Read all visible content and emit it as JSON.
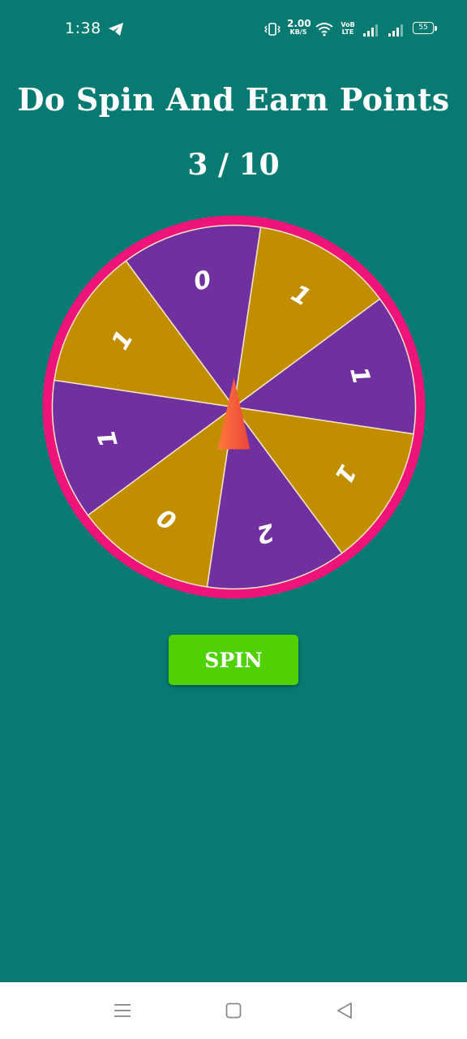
{
  "status_bar": {
    "time": "1:38",
    "net_speed_value": "2.00",
    "net_speed_unit": "KB/S",
    "volte_line1": "VoB",
    "volte_line2": "LTE",
    "battery": "55"
  },
  "header": {
    "title": "Do Spin And Earn Points",
    "spin_count": "3 / 10"
  },
  "wheel": {
    "segments": [
      {
        "label": "0",
        "color": "#7030a0"
      },
      {
        "label": "1",
        "color": "#c38d00"
      },
      {
        "label": "1",
        "color": "#7030a0"
      },
      {
        "label": "1",
        "color": "#c38d00"
      },
      {
        "label": "2",
        "color": "#7030a0"
      },
      {
        "label": "0",
        "color": "#c38d00"
      },
      {
        "label": "1",
        "color": "#7030a0"
      },
      {
        "label": "1",
        "color": "#c38d00"
      }
    ],
    "rim_color": "#ee1479",
    "pointer_color": "#f0553a"
  },
  "actions": {
    "spin_label": "SPIN"
  },
  "colors": {
    "background": "#077b72",
    "button": "#4fd106"
  }
}
